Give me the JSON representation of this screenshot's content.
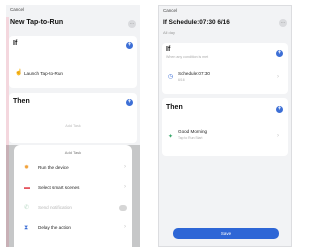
{
  "left_screen": {
    "cancel_label": "Cancel",
    "title": "New Tap-to-Run",
    "if_section": {
      "label": "If",
      "condition_label": "Launch Tap-to-Run"
    },
    "then_section": {
      "label": "Then",
      "add_task_hint": "Add Task"
    },
    "add_task_sheet": {
      "title": "Add Task",
      "items": [
        {
          "label": "Run the device",
          "icon": "lightbulb-icon",
          "state": "enabled"
        },
        {
          "label": "Select smart scenes",
          "icon": "scenes-icon",
          "state": "enabled"
        },
        {
          "label": "Send notification",
          "icon": "notification-icon",
          "state": "disabled"
        },
        {
          "label": "Delay the action",
          "icon": "hourglass-icon",
          "state": "enabled"
        }
      ]
    }
  },
  "right_screen": {
    "cancel_label": "Cancel",
    "title": "If Schedule:07:30 6/16",
    "subtitle": "All day",
    "if_section": {
      "label": "If",
      "hint": "When any condition is met",
      "condition": {
        "title": "Schedule:07:30",
        "sub": "6/16",
        "icon": "clock-icon"
      }
    },
    "then_section": {
      "label": "Then",
      "action": {
        "title": "Good Morning",
        "sub": "Tap to Run:Start",
        "icon": "leaf-icon"
      }
    },
    "save_label": "Save"
  },
  "colors": {
    "accent": "#3d6fd6",
    "save_button": "#2e66d6",
    "background": "#f2f3f5"
  }
}
